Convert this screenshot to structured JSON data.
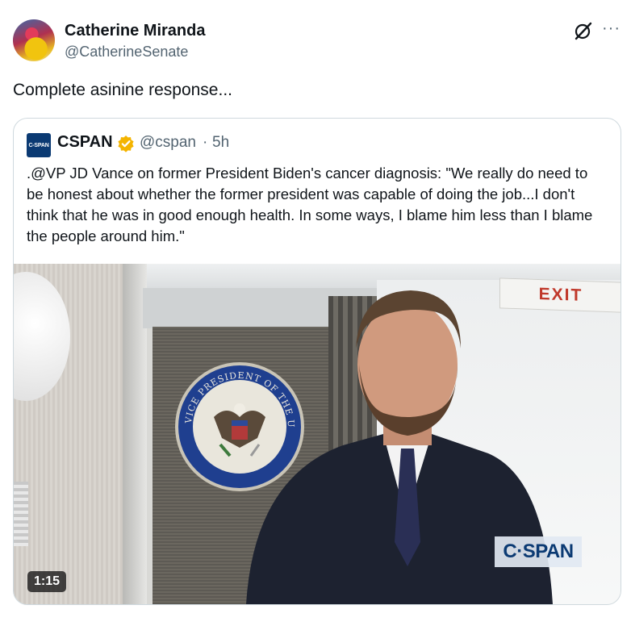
{
  "tweet": {
    "author_name": "Catherine Miranda",
    "author_handle": "@CatherineSenate",
    "text": "Complete asinine response...",
    "more_label": "···"
  },
  "quoted": {
    "logo_text": "C-SPAN",
    "name": "CSPAN",
    "handle": "@cspan",
    "separator": "·",
    "time": "5h",
    "text": ".@VP JD Vance on former President Biden's cancer diagnosis: \"We really do need to be honest about whether the former president was capable of doing the job...I don't think that he was in good enough health. In some ways, I blame him less than I blame the people around him.\"",
    "media": {
      "duration": "1:15",
      "watermark": "C·SPAN",
      "exit_sign": "EXIT",
      "seal_text_top": "VICE PRESIDENT OF THE UNITED STATES"
    }
  },
  "colors": {
    "verified": "#f4b400",
    "secondary_text": "#536471",
    "border": "#cfd9de",
    "cspan_blue": "#0b3a73"
  },
  "icons": [
    "grok-icon",
    "more-icon",
    "verified-icon",
    "avatar"
  ]
}
